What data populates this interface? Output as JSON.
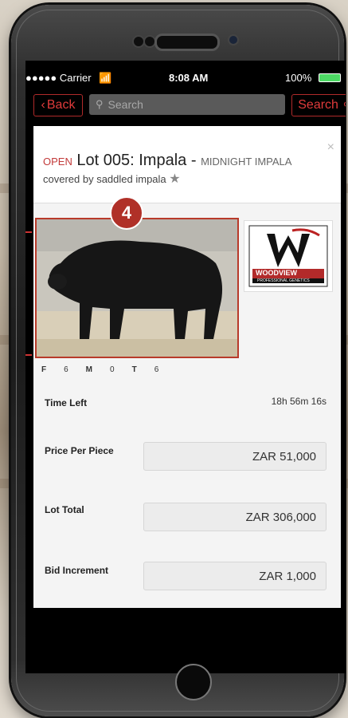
{
  "status_bar": {
    "carrier": "●●●●● Carrier",
    "time": "8:08 AM",
    "battery": "100%"
  },
  "nav": {
    "back_label": "Back",
    "search_placeholder": "Search",
    "search_button_label": "Search"
  },
  "lot": {
    "status": "OPEN",
    "title": "Lot 005: Impala -",
    "breed": "MIDNIGHT IMPALA",
    "subtitle": "covered by saddled impala",
    "badge_number": "4",
    "logo_text": "WOODVIEW",
    "logo_subtext": "PROFESSIONAL GENETICS",
    "sex_counts": [
      "F",
      "6",
      "M",
      "0",
      "T",
      "6"
    ]
  },
  "details": {
    "time_left_label": "Time Left",
    "time_left_value": "18h 56m 16s",
    "price_per_piece_label": "Price Per Piece",
    "price_per_piece_value": "ZAR 51,000",
    "lot_total_label": "Lot Total",
    "lot_total_value": "ZAR 306,000",
    "bid_increment_label": "Bid Increment",
    "bid_increment_value": "ZAR 1,000"
  },
  "colors": {
    "accent_red": "#c23a3a",
    "screen_bg": "#000000",
    "card_bg": "#f4f4f4"
  }
}
